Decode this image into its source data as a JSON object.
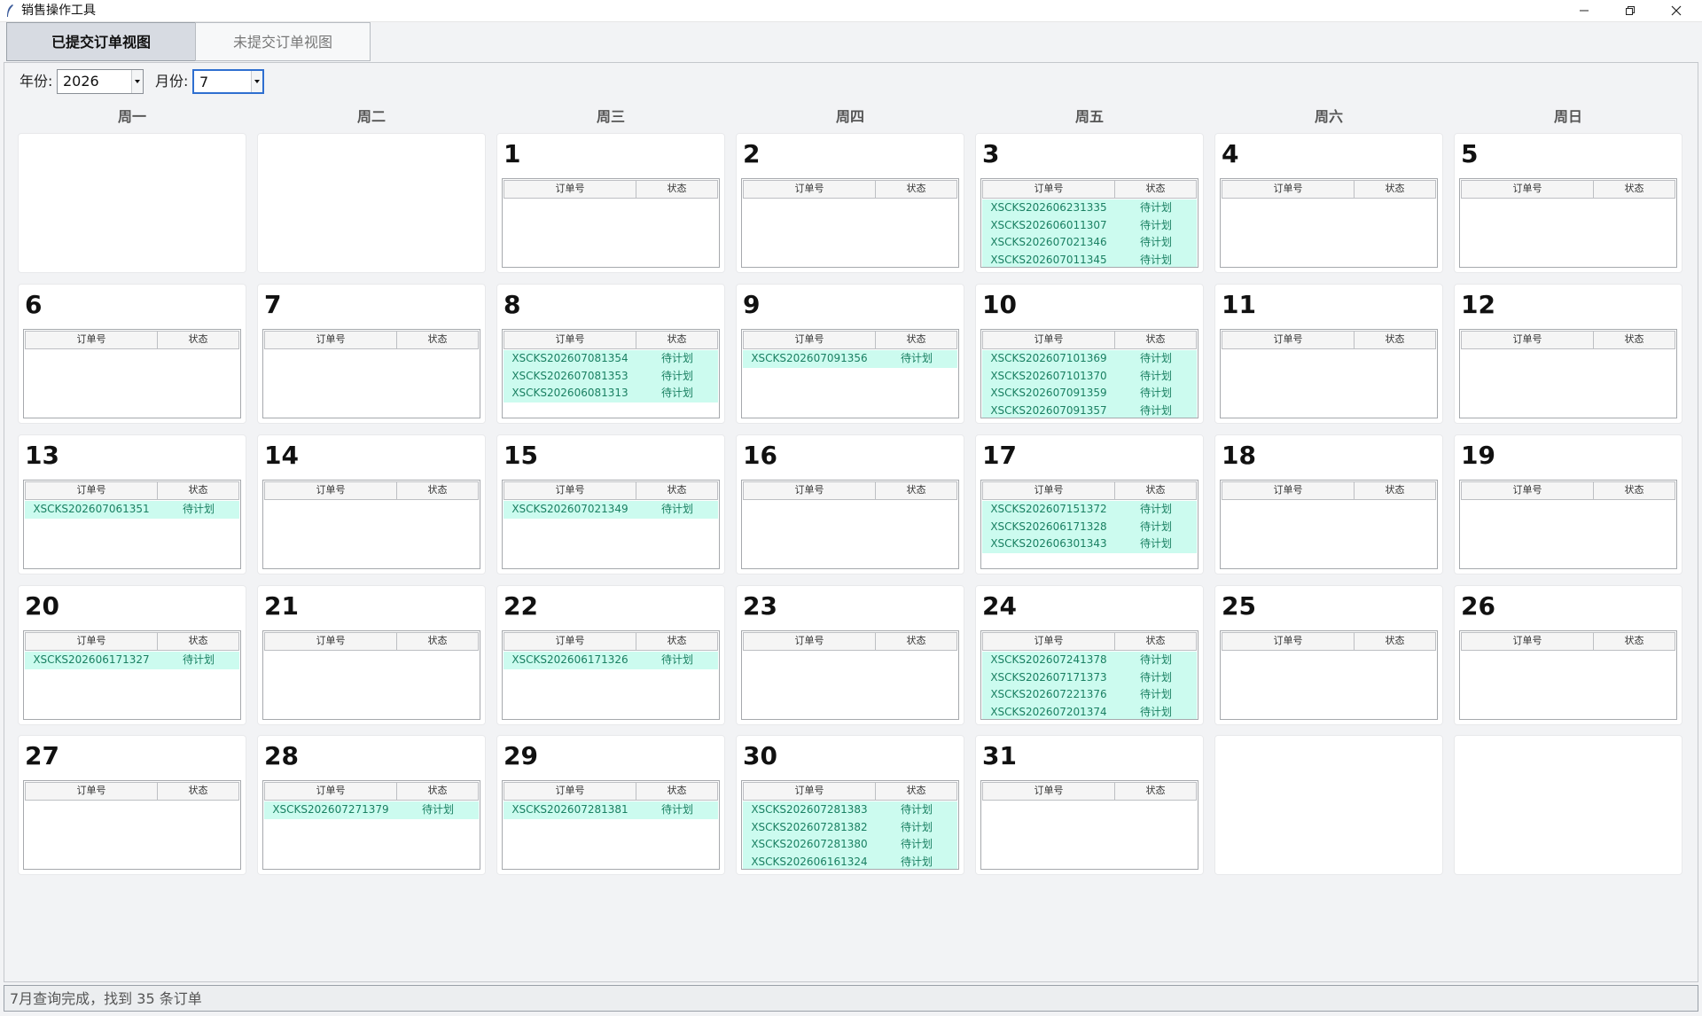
{
  "window": {
    "title": "销售操作工具",
    "icons": {
      "app": "feather-icon",
      "minimize": "minimize-icon",
      "restore": "restore-icon",
      "close": "close-icon"
    }
  },
  "tabs": [
    {
      "label": "已提交订单视图",
      "active": true
    },
    {
      "label": "未提交订单视图",
      "active": false
    }
  ],
  "filters": {
    "year_label": "年份:",
    "year_value": "2026",
    "month_label": "月份:",
    "month_value": "7"
  },
  "calendar": {
    "weekdays": [
      "周一",
      "周二",
      "周三",
      "周四",
      "周五",
      "周六",
      "周日"
    ],
    "columns": {
      "order": "订单号",
      "status": "状态"
    },
    "days": [
      {
        "day": "1",
        "orders": []
      },
      {
        "day": "2",
        "orders": []
      },
      {
        "day": "3",
        "orders": [
          {
            "order": "XSCKS202606231335",
            "status": "待计划"
          },
          {
            "order": "XSCKS202606011307",
            "status": "待计划"
          },
          {
            "order": "XSCKS202607021346",
            "status": "待计划"
          },
          {
            "order": "XSCKS202607011345",
            "status": "待计划"
          }
        ]
      },
      {
        "day": "4",
        "orders": []
      },
      {
        "day": "5",
        "orders": []
      },
      {
        "day": "6",
        "orders": []
      },
      {
        "day": "7",
        "orders": []
      },
      {
        "day": "8",
        "orders": [
          {
            "order": "XSCKS202607081354",
            "status": "待计划"
          },
          {
            "order": "XSCKS202607081353",
            "status": "待计划"
          },
          {
            "order": "XSCKS202606081313",
            "status": "待计划"
          }
        ]
      },
      {
        "day": "9",
        "orders": [
          {
            "order": "XSCKS202607091356",
            "status": "待计划"
          }
        ]
      },
      {
        "day": "10",
        "orders": [
          {
            "order": "XSCKS202607101369",
            "status": "待计划"
          },
          {
            "order": "XSCKS202607101370",
            "status": "待计划"
          },
          {
            "order": "XSCKS202607091359",
            "status": "待计划"
          },
          {
            "order": "XSCKS202607091357",
            "status": "待计划"
          }
        ]
      },
      {
        "day": "11",
        "orders": []
      },
      {
        "day": "12",
        "orders": []
      },
      {
        "day": "13",
        "orders": [
          {
            "order": "XSCKS202607061351",
            "status": "待计划"
          }
        ]
      },
      {
        "day": "14",
        "orders": []
      },
      {
        "day": "15",
        "orders": [
          {
            "order": "XSCKS202607021349",
            "status": "待计划"
          }
        ]
      },
      {
        "day": "16",
        "orders": []
      },
      {
        "day": "17",
        "orders": [
          {
            "order": "XSCKS202607151372",
            "status": "待计划"
          },
          {
            "order": "XSCKS202606171328",
            "status": "待计划"
          },
          {
            "order": "XSCKS202606301343",
            "status": "待计划"
          }
        ]
      },
      {
        "day": "18",
        "orders": []
      },
      {
        "day": "19",
        "orders": []
      },
      {
        "day": "20",
        "orders": [
          {
            "order": "XSCKS202606171327",
            "status": "待计划"
          }
        ]
      },
      {
        "day": "21",
        "orders": []
      },
      {
        "day": "22",
        "orders": [
          {
            "order": "XSCKS202606171326",
            "status": "待计划"
          }
        ]
      },
      {
        "day": "23",
        "orders": []
      },
      {
        "day": "24",
        "orders": [
          {
            "order": "XSCKS202607241378",
            "status": "待计划"
          },
          {
            "order": "XSCKS202607171373",
            "status": "待计划"
          },
          {
            "order": "XSCKS202607221376",
            "status": "待计划"
          },
          {
            "order": "XSCKS202607201374",
            "status": "待计划"
          }
        ]
      },
      {
        "day": "25",
        "orders": []
      },
      {
        "day": "26",
        "orders": []
      },
      {
        "day": "27",
        "orders": []
      },
      {
        "day": "28",
        "orders": [
          {
            "order": "XSCKS202607271379",
            "status": "待计划"
          }
        ]
      },
      {
        "day": "29",
        "orders": [
          {
            "order": "XSCKS202607281381",
            "status": "待计划"
          }
        ]
      },
      {
        "day": "30",
        "orders": [
          {
            "order": "XSCKS202607281383",
            "status": "待计划"
          },
          {
            "order": "XSCKS202607281382",
            "status": "待计划"
          },
          {
            "order": "XSCKS202607281380",
            "status": "待计划"
          },
          {
            "order": "XSCKS202606161324",
            "status": "待计划"
          }
        ]
      },
      {
        "day": "31",
        "orders": []
      }
    ]
  },
  "status_bar": {
    "text": "7月查询完成，找到 35 条订单"
  }
}
